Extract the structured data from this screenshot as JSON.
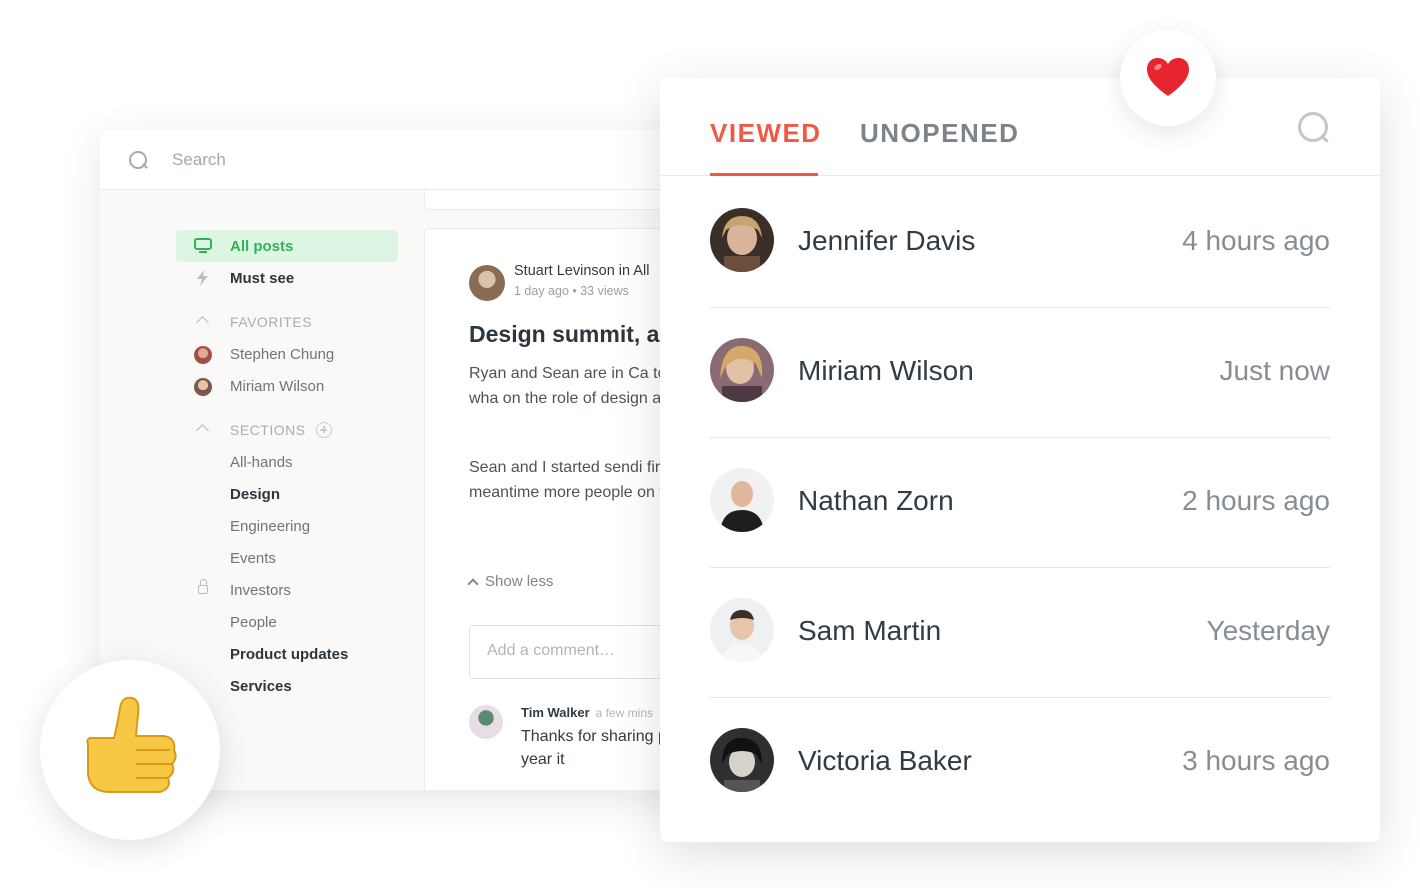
{
  "app": {
    "search_placeholder": "Search",
    "nav": {
      "all_posts": "All posts",
      "must_see": "Must see",
      "favorites_header": "FAVORITES",
      "favorites": [
        "Stephen Chung",
        "Miriam Wilson"
      ],
      "sections_header": "SECTIONS",
      "sections": [
        {
          "label": "All-hands",
          "bold": false
        },
        {
          "label": "Design",
          "bold": true
        },
        {
          "label": "Engineering",
          "bold": false
        },
        {
          "label": "Events",
          "bold": false
        },
        {
          "label": "Investors",
          "bold": false,
          "locked": true
        },
        {
          "label": "People",
          "bold": false
        },
        {
          "label": "Product updates",
          "bold": true
        },
        {
          "label": "Services",
          "bold": true
        }
      ]
    },
    "post": {
      "author_line": "Stuart Levinson in All",
      "meta": "1 day ago  •  33 views",
      "title": "Design summit, a",
      "paragraph1": "Ryan and Sean are in Ca to identify the who, wha on the role of design an",
      "paragraph2": "Sean and I started sendi first hit? In the meantime more people on the plat feedback.",
      "show_less": "Show less",
      "comment_placeholder": "Add a comment…",
      "comment": {
        "author": "Tim Walker",
        "time": "a few mins",
        "text": "Thanks for sharing place? Last year it"
      }
    }
  },
  "panel": {
    "tabs": [
      {
        "label": "VIEWED",
        "active": true
      },
      {
        "label": "UNOPENED",
        "active": false
      }
    ],
    "viewers": [
      {
        "name": "Jennifer Davis",
        "time": "4 hours ago"
      },
      {
        "name": "Miriam Wilson",
        "time": "Just now"
      },
      {
        "name": "Nathan Zorn",
        "time": "2 hours ago"
      },
      {
        "name": "Sam Martin",
        "time": "Yesterday"
      },
      {
        "name": "Victoria Baker",
        "time": "3 hours ago"
      }
    ]
  },
  "colors": {
    "accent_red": "#ef5a47",
    "accent_green": "#35b155",
    "active_nav_bg": "#ddf5e3"
  },
  "icons": {
    "heart_badge": "heart-emoji-icon",
    "thumb_badge": "thumbs-up-emoji-icon"
  }
}
